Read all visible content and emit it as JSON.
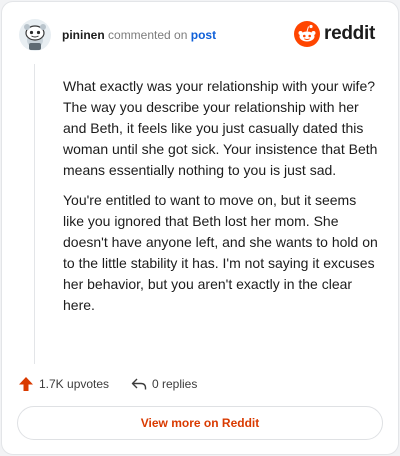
{
  "header": {
    "username": "pininen",
    "action": "commented on",
    "post_link": "post",
    "logo_text": "reddit"
  },
  "comment": {
    "paragraphs": [
      "What exactly was your relationship with your wife? The way you describe your relationship with her and Beth, it feels like you just casually dated this woman until she got sick. Your insistence that Beth means essentially nothing to you is just sad.",
      "You're entitled to want to move on, but it seems like you ignored that Beth lost her mom. She doesn't have anyone left, and she wants to hold on to the little stability it has. I'm not saying it excuses her behavior, but you aren't exactly in the clear here."
    ]
  },
  "footer": {
    "upvotes": "1.7K upvotes",
    "replies": "0 replies"
  },
  "cta": {
    "label": "View more on Reddit"
  },
  "colors": {
    "brand": "#ff4500",
    "link": "#0e5fd8",
    "cta_text": "#d93a00",
    "upvote": "#d93a00"
  },
  "icons": {
    "avatar": "snoo-avatar-icon",
    "logo": "reddit-logo-icon",
    "upvote": "upvote-arrow-icon",
    "reply": "reply-arrow-icon"
  }
}
